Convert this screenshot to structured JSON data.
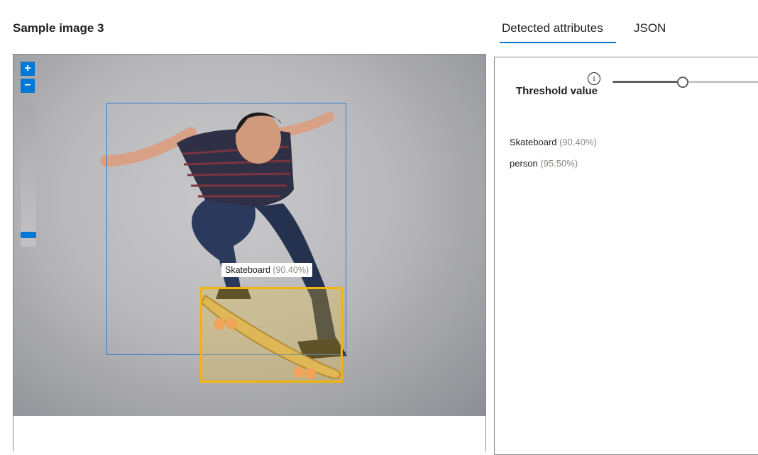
{
  "page": {
    "title": "Sample image 3"
  },
  "viewer": {
    "zoom_in_label": "+",
    "zoom_out_label": "−",
    "zoom_level": 0.1,
    "tag": {
      "name": "Skateboard",
      "score": "(90.40%)"
    }
  },
  "tabs": [
    {
      "label": "Detected attributes",
      "active": true
    },
    {
      "label": "JSON",
      "active": false
    }
  ],
  "panel": {
    "threshold_label": "Threshold value",
    "info_icon": "info-icon",
    "threshold_value": 0.45,
    "attributes": [
      {
        "name": "Skateboard",
        "score": "(90.40%)"
      },
      {
        "name": "person",
        "score": "(95.50%)"
      }
    ]
  },
  "colors": {
    "accent": "#0078d4",
    "person_box": "#2b7bd0",
    "skateboard_box": "#f2b40a"
  }
}
